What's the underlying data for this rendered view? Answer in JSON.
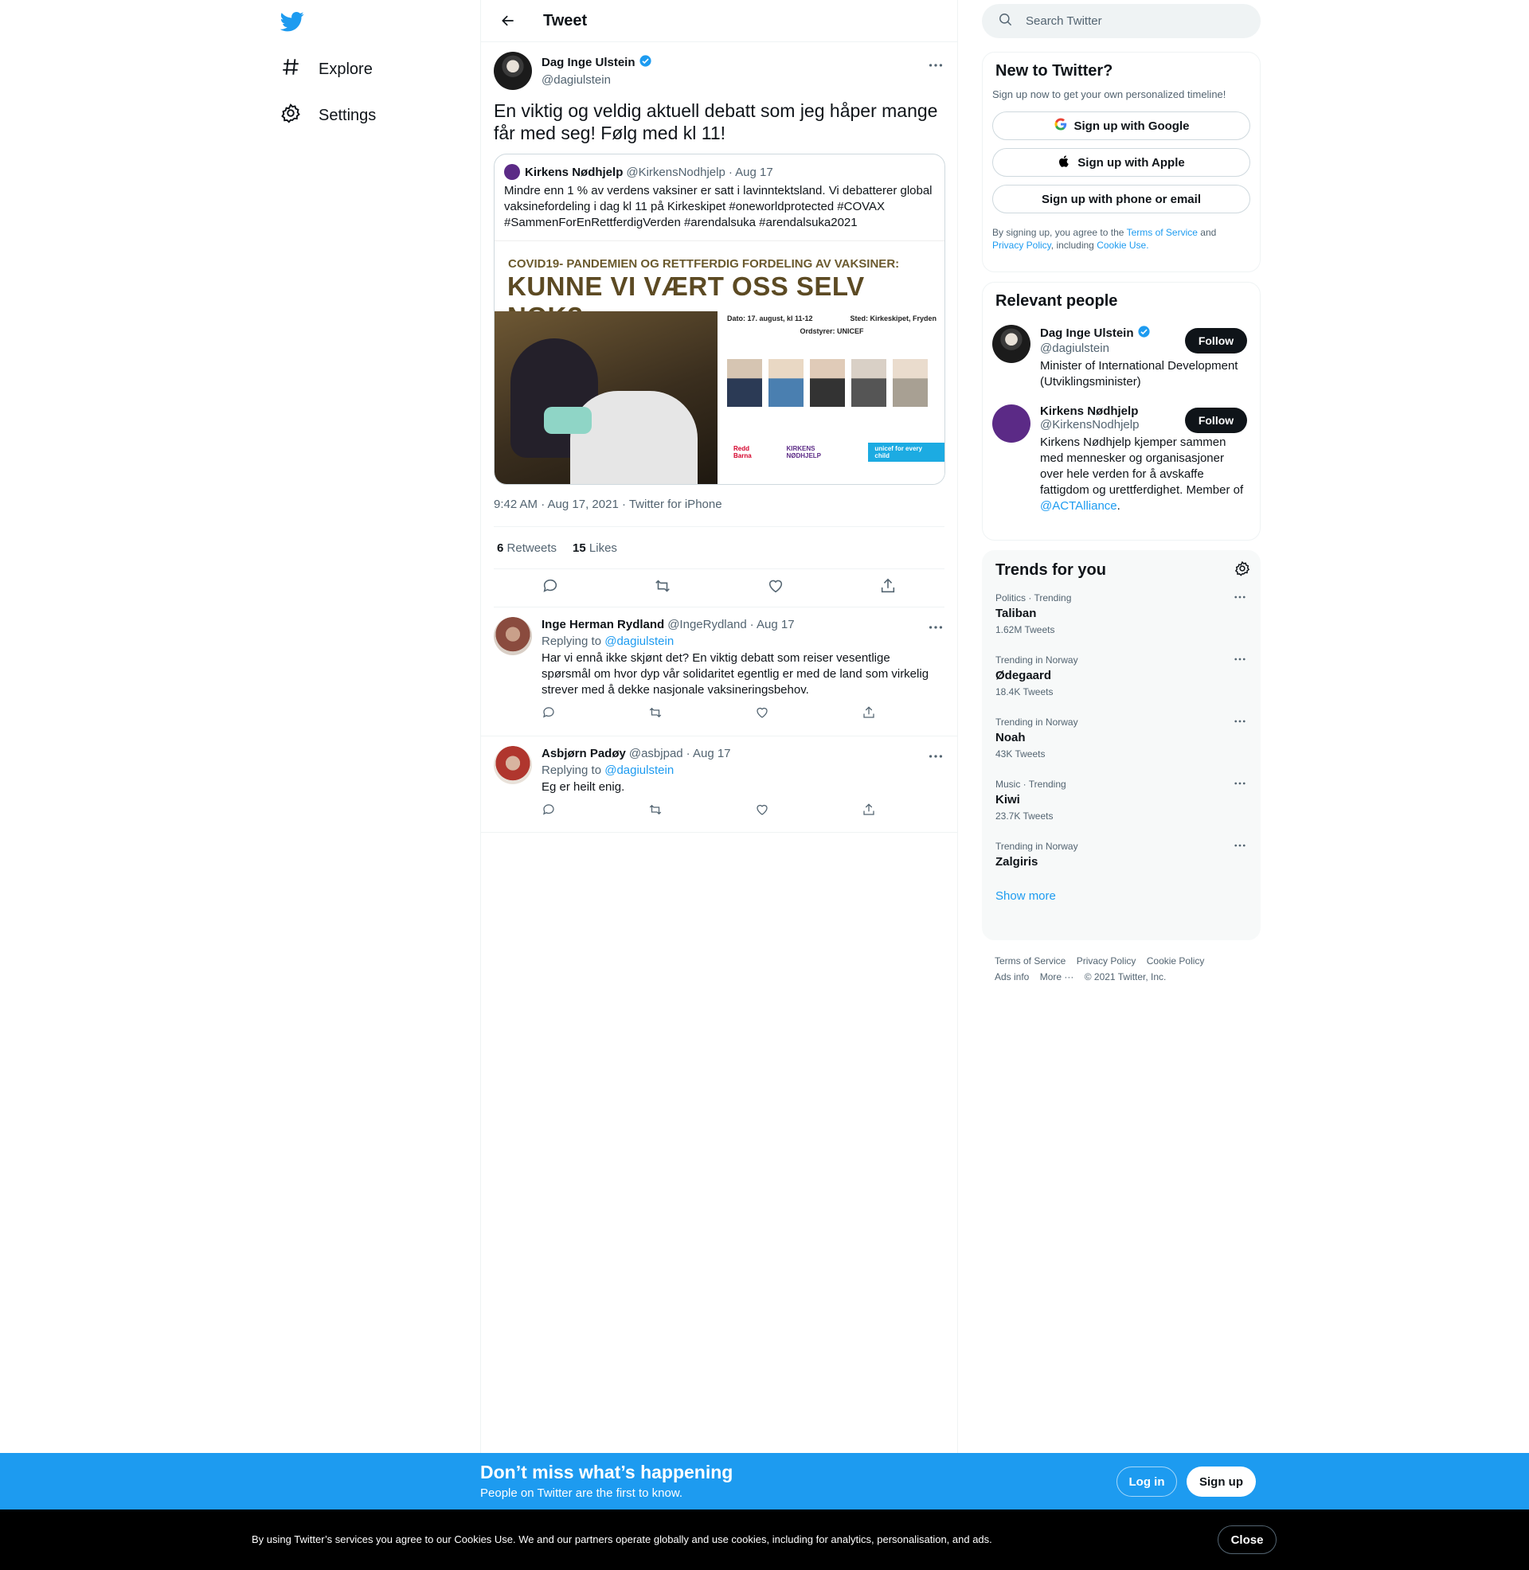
{
  "nav": {
    "explore": "Explore",
    "settings": "Settings"
  },
  "header": {
    "title": "Tweet"
  },
  "tweet": {
    "author_name": "Dag Inge Ulstein",
    "author_handle": "@dagiulstein",
    "text": "En viktig og veldig aktuell debatt som jeg håper mange får med seg! Følg med kl 11!",
    "quote": {
      "name": "Kirkens Nødhjelp",
      "handle": "@KirkensNodhjelp",
      "date": "· Aug 17",
      "text": "Mindre enn 1 % av verdens vaksiner er satt i lavinntektsland. Vi debatterer global vaksinefordeling i dag kl 11 på Kirkeskipet #oneworldprotected #COVAX #SammenForEnRettferdigVerden #arendalsuka #arendalsuka2021",
      "image": {
        "subtitle": "COVID19- PANDEMIEN OG RETTFERDIG FORDELING AV VAKSINER:",
        "title": "KUNNE VI VÆRT OSS SELV NOK?",
        "date": "Dato: 17. august, kl 11-12",
        "place": "Sted: Kirkeskipet, Fryden",
        "moderator": "Ordstyrer: UNICEF",
        "logo1": "Redd Barna",
        "logo2": "KIRKENS NØDHJELP",
        "logo3": "unicef for every child"
      }
    },
    "meta": "9:42 AM · Aug 17, 2021 · Twitter for iPhone",
    "retweets_count": "6",
    "retweets_label": "Retweets",
    "likes_count": "15",
    "likes_label": "Likes"
  },
  "replies": [
    {
      "name": "Inge Herman Rydland",
      "handle": "@IngeRydland",
      "date": "· Aug 17",
      "replying_prefix": "Replying to",
      "replying_to": "@dagiulstein",
      "text": "Har vi ennå ikke skjønt det? En viktig debatt som reiser vesentlige spørsmål om hvor dyp vår solidaritet egentlig er med de land som virkelig strever med å dekke nasjonale vaksineringsbehov."
    },
    {
      "name": "Asbjørn Padøy",
      "handle": "@asbjpad",
      "date": "· Aug 17",
      "replying_prefix": "Replying to",
      "replying_to": "@dagiulstein",
      "text": "Eg er heilt enig."
    }
  ],
  "search": {
    "placeholder": "Search Twitter"
  },
  "signup_box": {
    "title": "New to Twitter?",
    "subtitle": "Sign up now to get your own personalized timeline!",
    "google": "Sign up with Google",
    "apple": "Sign up with Apple",
    "phone": "Sign up with phone or email",
    "legal_1": "By signing up, you agree to the",
    "terms": "Terms of Service",
    "and": "and",
    "privacy": "Privacy Policy",
    "including": ", including",
    "cookie": "Cookie Use."
  },
  "relevant": {
    "title": "Relevant people",
    "people": [
      {
        "name": "Dag Inge Ulstein",
        "handle": "@dagiulstein",
        "bio": "Minister of International Development (Utviklingsminister)",
        "follow": "Follow"
      },
      {
        "name": "Kirkens Nødhjelp",
        "handle": "@KirkensNodhjelp",
        "bio": "Kirkens Nødhjelp kjemper sammen med mennesker og organisasjoner over hele verden for å avskaffe fattigdom og urettferdighet. Member of",
        "bio_link": "@ACTAlliance",
        "bio_end": ".",
        "follow": "Follow"
      }
    ]
  },
  "trends": {
    "title": "Trends for you",
    "items": [
      {
        "context": "Politics · Trending",
        "name": "Taliban",
        "count": "1.62M Tweets"
      },
      {
        "context": "Trending in Norway",
        "name": "Ødegaard",
        "count": "18.4K Tweets"
      },
      {
        "context": "Trending in Norway",
        "name": "Noah",
        "count": "43K Tweets"
      },
      {
        "context": "Music · Trending",
        "name": "Kiwi",
        "count": "23.7K Tweets"
      },
      {
        "context": "Trending in Norway",
        "name": "Zalgiris",
        "count": ""
      }
    ],
    "show_more": "Show more"
  },
  "footer": {
    "terms": "Terms of Service",
    "privacy": "Privacy Policy",
    "cookie": "Cookie Policy",
    "ads": "Ads info",
    "more": "More ···",
    "copyright": "© 2021 Twitter, Inc."
  },
  "banner": {
    "title": "Don’t miss what’s happening",
    "subtitle": "People on Twitter are the first to know.",
    "login": "Log in",
    "signup": "Sign up"
  },
  "cookie_bar": {
    "text": "By using Twitter’s services you agree to our Cookies Use. We and our partners operate globally and use cookies, including for analytics, personalisation, and ads.",
    "close": "Close"
  },
  "colors": {
    "accent": "#1d9bf0",
    "dark": "#0f1419",
    "muted": "#536471"
  }
}
